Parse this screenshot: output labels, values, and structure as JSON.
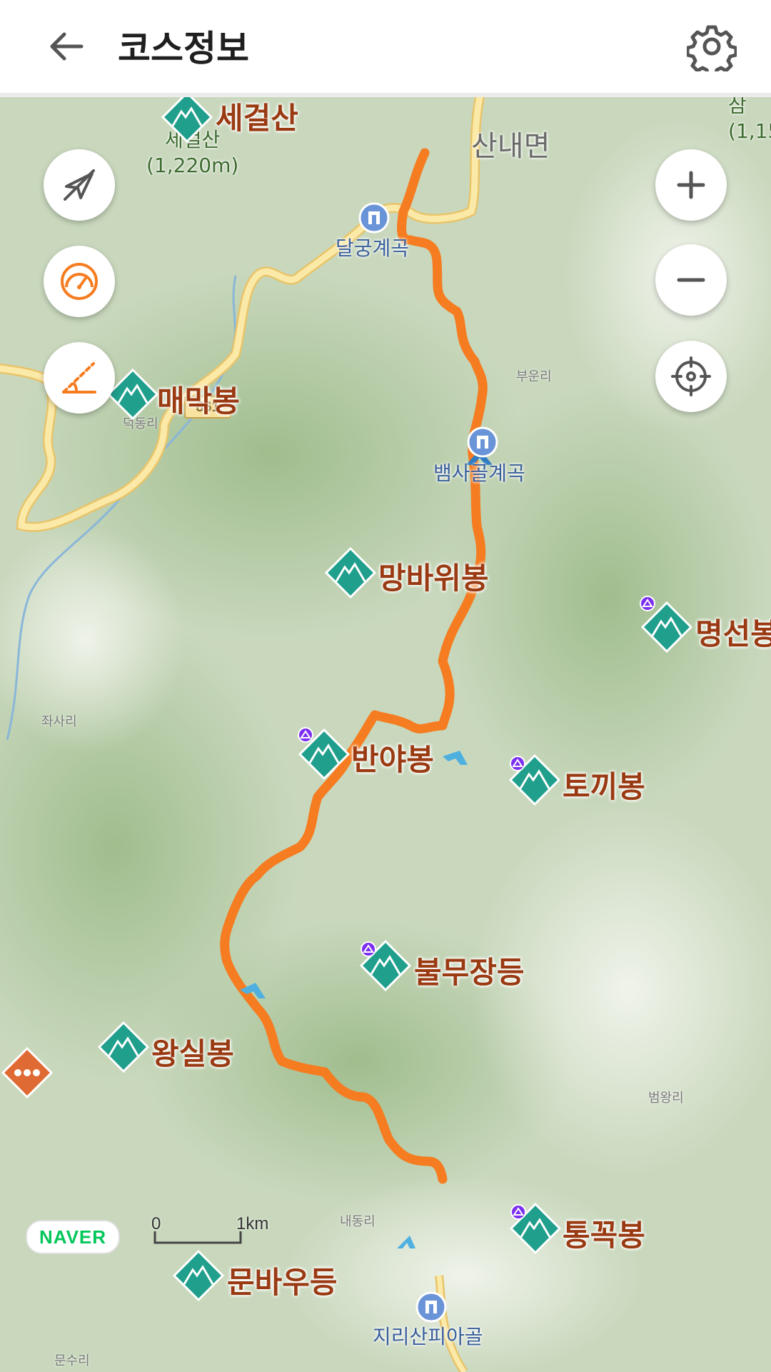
{
  "header": {
    "title": "코스정보",
    "back_icon": "arrow-left-icon",
    "settings_icon": "gear-icon"
  },
  "map": {
    "left_controls": [
      {
        "name": "compass-off-button",
        "icon": "navigation-off-icon"
      },
      {
        "name": "speedometer-button",
        "icon": "speedometer-icon"
      },
      {
        "name": "altitude-button",
        "icon": "slope-icon"
      }
    ],
    "right_controls": [
      {
        "name": "zoom-in-button",
        "icon": "plus-icon"
      },
      {
        "name": "zoom-out-button",
        "icon": "minus-icon"
      },
      {
        "name": "locate-button",
        "icon": "crosshair-icon"
      }
    ],
    "peaks": [
      {
        "label": "세걸산"
      },
      {
        "label": "매막봉"
      },
      {
        "label": "망바위봉"
      },
      {
        "label": "명선봉"
      },
      {
        "label": "반야봉"
      },
      {
        "label": "토끼봉"
      },
      {
        "label": "불무장등"
      },
      {
        "label": "왕실봉"
      },
      {
        "label": "통꼭봉"
      },
      {
        "label": "문바우등"
      }
    ],
    "peak_elevation": {
      "name": "세걸산",
      "height": "(1,220m)"
    },
    "partial_label_top_right": {
      "name": "삼",
      "height": "(1,15"
    },
    "town": "산내면",
    "road_number": "861",
    "pois": [
      {
        "label": "달궁계곡"
      },
      {
        "label": "뱀사골계곡"
      },
      {
        "label": "지리산피아골"
      }
    ],
    "villages": [
      "부운리",
      "덕동리",
      "좌사리",
      "범왕리",
      "내동리",
      "문수리"
    ],
    "colors": {
      "route": "#f57c20",
      "peak_marker": "#1f9f8c",
      "road": "#f6dc8e",
      "label": "#9a3a12"
    },
    "brand": "NAVER",
    "scale": {
      "zero": "0",
      "end": "1km"
    }
  }
}
